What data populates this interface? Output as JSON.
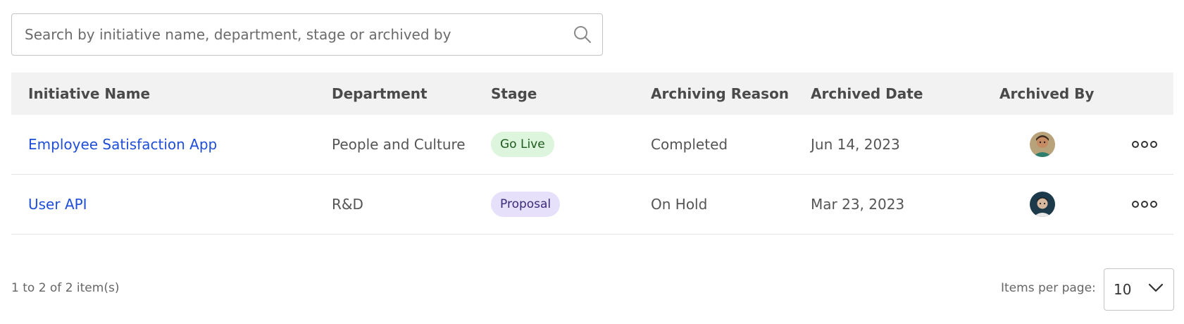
{
  "search": {
    "placeholder": "Search by initiative name, department, stage or archived by",
    "icon": "search-icon"
  },
  "table": {
    "columns": [
      "Initiative Name",
      "Department",
      "Stage",
      "Archiving Reason",
      "Archived Date",
      "Archived By"
    ],
    "rows": [
      {
        "name": "Employee Satisfaction App",
        "department": "People and Culture",
        "stage": "Go Live",
        "stage_bg": "#dcf5dc",
        "stage_color": "#1e5a1e",
        "reason": "Completed",
        "date": "Jun 14, 2023",
        "avatar": "avatar-icon"
      },
      {
        "name": "User API",
        "department": "R&D",
        "stage": "Proposal",
        "stage_bg": "#e6e0fa",
        "stage_color": "#3b2a7a",
        "reason": "On Hold",
        "date": "Mar 23, 2023",
        "avatar": "avatar-icon"
      }
    ]
  },
  "footer": {
    "count_text": "1 to 2 of 2 item(s)",
    "items_per_page_label": "Items per page:",
    "items_per_page_value": "10"
  },
  "colors": {
    "link": "#1f4ed8",
    "header_bg": "#f2f2f2"
  }
}
